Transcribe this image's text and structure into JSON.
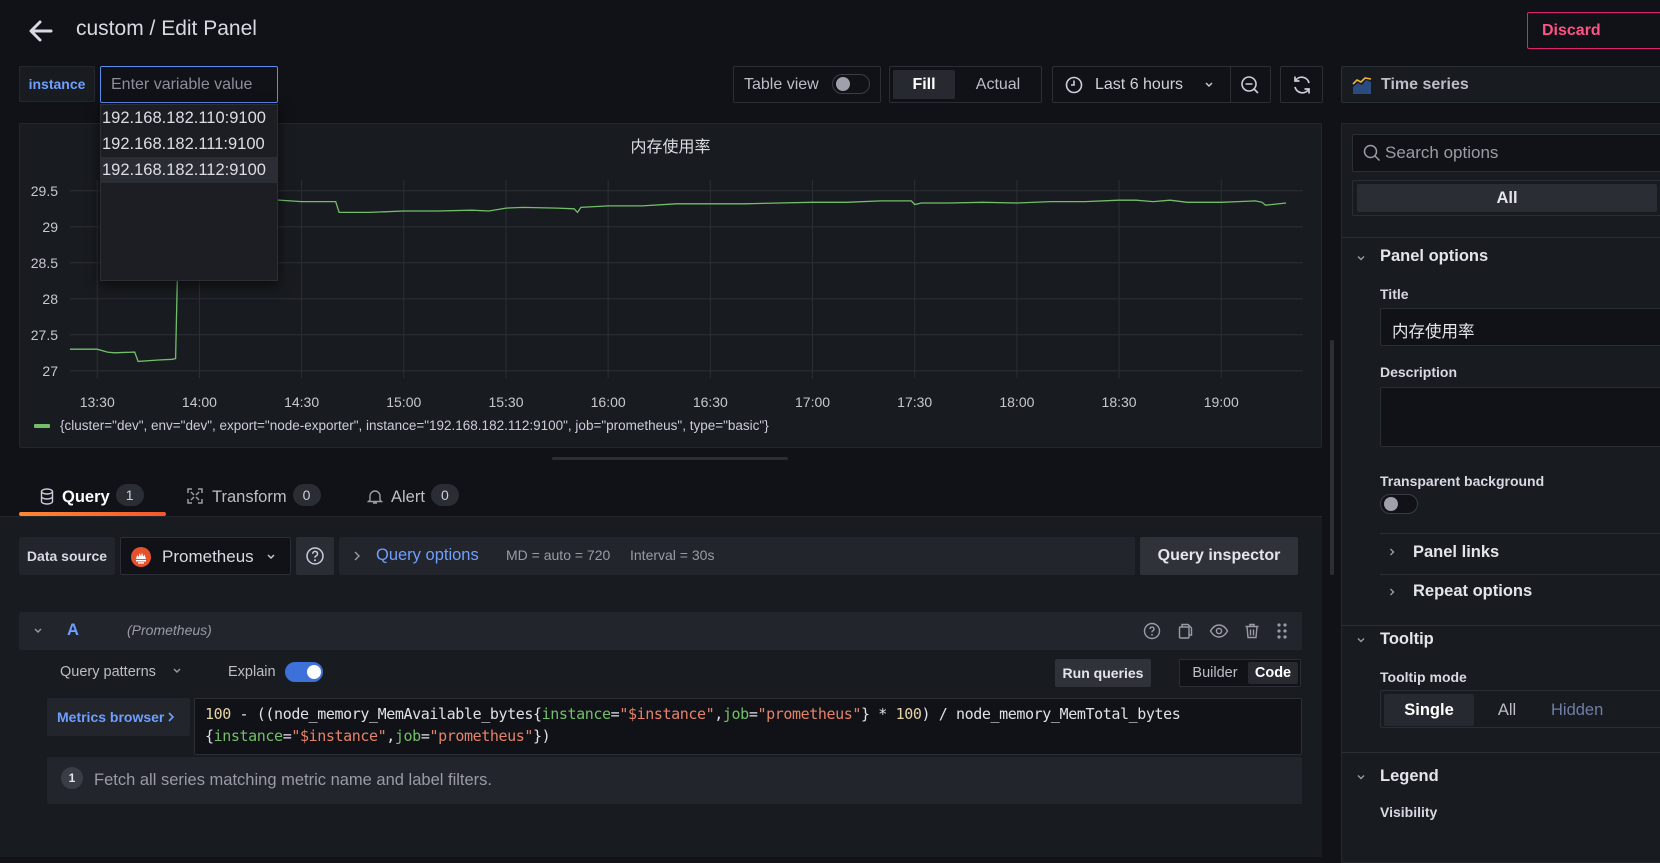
{
  "header": {
    "title": "custom / Edit Panel",
    "discard_label": "Discard"
  },
  "variable": {
    "label": "instance",
    "placeholder": "Enter variable value",
    "value": "",
    "options": [
      "192.168.182.110:9100",
      "192.168.182.111:9100",
      "192.168.182.112:9100"
    ],
    "highlighted_index": 2
  },
  "toolbar": {
    "table_view_label": "Table view",
    "table_view_on": false,
    "fill_label": "Fill",
    "actual_label": "Actual",
    "active_size_mode": "Fill",
    "time_range": "Last 6 hours",
    "visualization": "Time series"
  },
  "panel": {
    "title": "内存使用率",
    "legend": "{cluster=\"dev\", env=\"dev\", export=\"node-exporter\", instance=\"192.168.182.112:9100\", job=\"prometheus\", type=\"basic\"}"
  },
  "chart_data": {
    "type": "line",
    "title": "内存使用率",
    "xlabel": "",
    "ylabel": "",
    "x_ticks": [
      "13:30",
      "14:00",
      "14:30",
      "15:00",
      "15:30",
      "16:00",
      "16:30",
      "17:00",
      "17:30",
      "18:00",
      "18:30",
      "19:00"
    ],
    "y_ticks": [
      27,
      27.5,
      28,
      28.5,
      29,
      29.5
    ],
    "ylim": [
      26.9,
      29.65
    ],
    "xlim": [
      "13:22",
      "19:24"
    ],
    "grid": true,
    "legend_position": "bottom-left",
    "series": [
      {
        "name": "{cluster=\"dev\", env=\"dev\", export=\"node-exporter\", instance=\"192.168.182.112:9100\", job=\"prometheus\", type=\"basic\"}",
        "color": "#73bf69",
        "x": [
          "13:22",
          "13:30",
          "13:33",
          "13:35",
          "13:41",
          "13:42",
          "13:48",
          "13:52",
          "13:53",
          "13:54",
          "14:00",
          "14:20",
          "14:30",
          "14:40",
          "14:41",
          "14:50",
          "15:00",
          "15:10",
          "15:20",
          "15:25",
          "15:30",
          "15:35",
          "15:45",
          "15:50",
          "15:51",
          "15:52",
          "16:00",
          "16:10",
          "16:20",
          "16:30",
          "16:40",
          "16:50",
          "17:00",
          "17:10",
          "17:20",
          "17:29",
          "17:30",
          "17:32",
          "17:40",
          "17:50",
          "18:00",
          "18:10",
          "18:20",
          "18:30",
          "18:35",
          "18:40",
          "18:45",
          "18:50",
          "19:00",
          "19:05",
          "19:10",
          "19:12",
          "19:13",
          "19:19"
        ],
        "y": [
          27.3,
          27.3,
          27.26,
          27.25,
          27.26,
          27.13,
          27.15,
          27.16,
          27.17,
          29.38,
          29.38,
          29.38,
          29.35,
          29.35,
          29.2,
          29.2,
          29.22,
          29.22,
          29.23,
          29.22,
          29.26,
          29.27,
          29.26,
          29.25,
          29.2,
          29.27,
          29.29,
          29.29,
          29.32,
          29.32,
          29.32,
          29.33,
          29.34,
          29.34,
          29.36,
          29.36,
          29.31,
          29.33,
          29.33,
          29.34,
          29.33,
          29.35,
          29.35,
          29.37,
          29.37,
          29.35,
          29.37,
          29.34,
          29.34,
          29.35,
          29.36,
          29.34,
          29.3,
          29.33
        ]
      }
    ]
  },
  "tabs": [
    {
      "label": "Query",
      "count": "1",
      "active": true
    },
    {
      "label": "Transform",
      "count": "0",
      "active": false
    },
    {
      "label": "Alert",
      "count": "0",
      "active": false
    }
  ],
  "query": {
    "data_source_label": "Data source",
    "data_source": "Prometheus",
    "query_options_label": "Query options",
    "md": "MD = auto = 720",
    "interval": "Interval = 30s",
    "inspector_label": "Query inspector",
    "row_letter": "A",
    "row_ds": "(Prometheus)",
    "query_patterns_label": "Query patterns",
    "explain_label": "Explain",
    "explain_on": true,
    "run_label": "Run queries",
    "builder_label": "Builder",
    "code_label": "Code",
    "active_mode": "Code",
    "metrics_browser_label": "Metrics browser",
    "expr_line1": [
      {
        "t": "100",
        "c": "num"
      },
      {
        "t": " - ((node_memory_MemAvailable_bytes{",
        "c": ""
      },
      {
        "t": "instance",
        "c": "label"
      },
      {
        "t": "=",
        "c": ""
      },
      {
        "t": "\"$instance\"",
        "c": "str"
      },
      {
        "t": ",",
        "c": ""
      },
      {
        "t": "job",
        "c": "label"
      },
      {
        "t": "=",
        "c": ""
      },
      {
        "t": "\"prometheus\"",
        "c": "str"
      },
      {
        "t": "} * ",
        "c": ""
      },
      {
        "t": "100",
        "c": "num"
      },
      {
        "t": ") / node_memory_MemTotal_bytes",
        "c": ""
      }
    ],
    "expr_line2": [
      {
        "t": "{",
        "c": ""
      },
      {
        "t": "instance",
        "c": "label"
      },
      {
        "t": "=",
        "c": ""
      },
      {
        "t": "\"$instance\"",
        "c": "str"
      },
      {
        "t": ",",
        "c": ""
      },
      {
        "t": "job",
        "c": "label"
      },
      {
        "t": "=",
        "c": ""
      },
      {
        "t": "\"prometheus\"",
        "c": "str"
      },
      {
        "t": "})",
        "c": ""
      }
    ],
    "explain_step": "1",
    "explain_text": "Fetch all series matching metric name and label filters."
  },
  "options": {
    "search_placeholder": "Search options",
    "all_tab_label": "All",
    "panel_options_label": "Panel options",
    "title_label": "Title",
    "title_value": "内存使用率",
    "description_label": "Description",
    "description_value": "",
    "transparent_label": "Transparent background",
    "transparent_on": false,
    "panel_links_label": "Panel links",
    "repeat_options_label": "Repeat options",
    "tooltip_label": "Tooltip",
    "tooltip_mode_label": "Tooltip mode",
    "tooltip_modes": [
      "Single",
      "All",
      "Hidden"
    ],
    "tooltip_active": "Single",
    "legend_label": "Legend",
    "visibility_label": "Visibility"
  }
}
